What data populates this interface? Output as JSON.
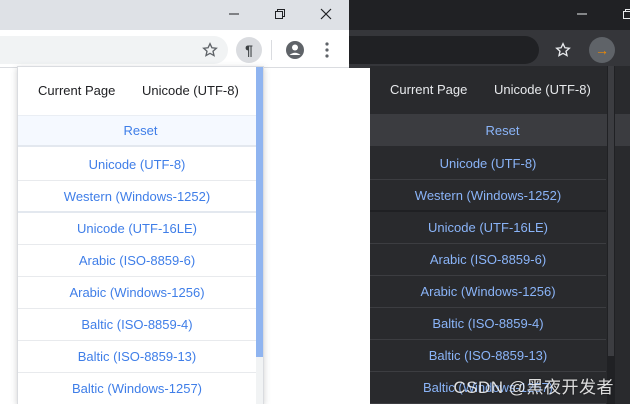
{
  "popup": {
    "header_left": "Current Page",
    "header_right": "Unicode (UTF-8)",
    "reset_label": "Reset",
    "items": [
      "Unicode (UTF-8)",
      "Western (Windows-1252)",
      "Unicode (UTF-16LE)",
      "Arabic (ISO-8859-6)",
      "Arabic (Windows-1256)",
      "Baltic (ISO-8859-4)",
      "Baltic (ISO-8859-13)",
      "Baltic (Windows-1257)"
    ]
  },
  "extension": {
    "icon_glyph": "¶",
    "dark_icon_glyph": "→"
  },
  "watermark": "CSDN @黑夜开发者",
  "colors": {
    "light_accent": "#3f7ee8",
    "dark_accent": "#8ab4f8",
    "dark_bg": "#292a2d",
    "ext_orange": "#f28b00"
  },
  "icons": [
    "minimize-icon",
    "restore-icon",
    "close-icon",
    "star-icon",
    "pilcrow-icon",
    "account-icon",
    "more-vert-icon"
  ]
}
